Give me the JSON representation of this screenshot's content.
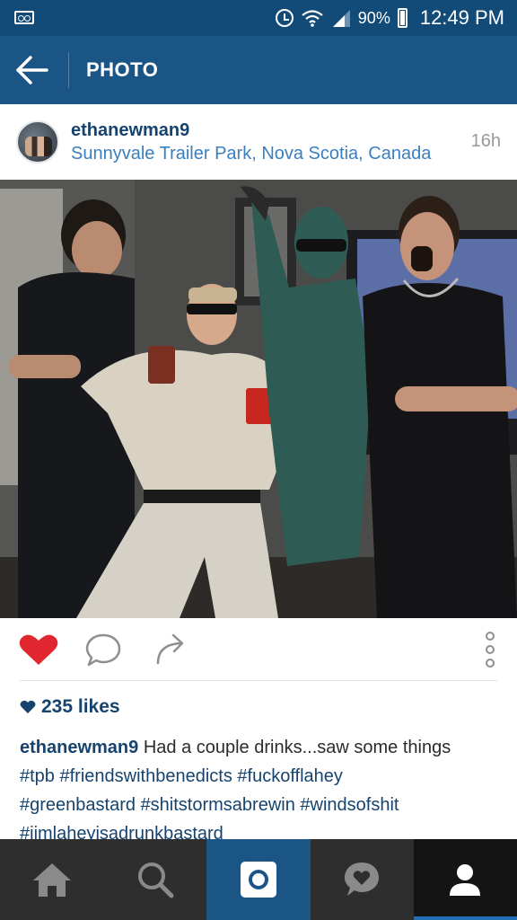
{
  "status_bar": {
    "battery_percent": "90%",
    "time": "12:49 PM",
    "icons": [
      "voicemail-icon",
      "alarm-icon",
      "wifi-icon",
      "signal-icon",
      "battery-icon"
    ]
  },
  "app_bar": {
    "title": "PHOTO",
    "back_icon": "arrow-left-icon"
  },
  "post": {
    "username": "ethanewman9",
    "location": "Sunnyvale Trailer Park, Nova Scotia, Canada",
    "time_ago": "16h",
    "liked": true,
    "likes_text": "235 likes",
    "caption_user": "ethanewman9",
    "caption_text": " Had a couple drinks...saw some things",
    "hashtags": [
      "#tpb",
      "#friendswithbenedicts",
      "#fuckofflahey",
      "#greenbastard",
      "#shitstormsabrewin",
      "#windsofshit",
      "#jimlaheyisadrunkbastard"
    ]
  },
  "colors": {
    "status_bar": "#124a78",
    "app_bar": "#1a5585",
    "brand_blue": "#16436d",
    "link_blue": "#3a7fc0",
    "like_red": "#e0262f",
    "nav_bg": "#2e2e2e"
  },
  "bottom_nav": {
    "items": [
      "home-icon",
      "search-icon",
      "camera-icon",
      "activity-icon",
      "profile-icon"
    ],
    "active": "profile-icon"
  }
}
